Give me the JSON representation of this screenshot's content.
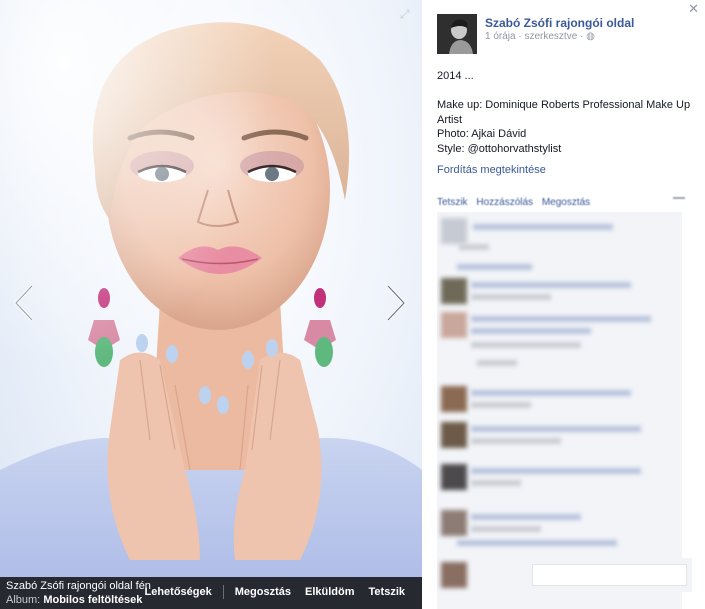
{
  "photo": {
    "page_title": "Szabó Zsófi rajongói oldal fén",
    "album_label": "Album:",
    "album_name": "Mobilos feltöltések",
    "actions": [
      "Lehetőségek",
      "Megosztás",
      "Elküldöm",
      "Tetszik"
    ],
    "prev_icon": "chevron-left-icon",
    "next_icon": "chevron-right-icon",
    "expand_icon": "fullscreen-icon"
  },
  "post": {
    "page_name": "Szabó Zsófi rajongói oldal",
    "time": "1 órája",
    "edited": "szerkesztve",
    "lines": [
      "2014 ...",
      "",
      "Make up: Dominique Roberts Professional Make Up Artist",
      "Photo: Ajkai Dávid",
      "Style: @ottohorvathstylist"
    ],
    "translate_link": "Fordítás megtekintése",
    "action_like": "Tetszik",
    "action_comment": "Hozzászólás",
    "action_share": "Megosztás"
  },
  "colors": {
    "link": "#3b5998",
    "bar_bg": "#141418",
    "comment_bg": "#f2f4f8"
  }
}
